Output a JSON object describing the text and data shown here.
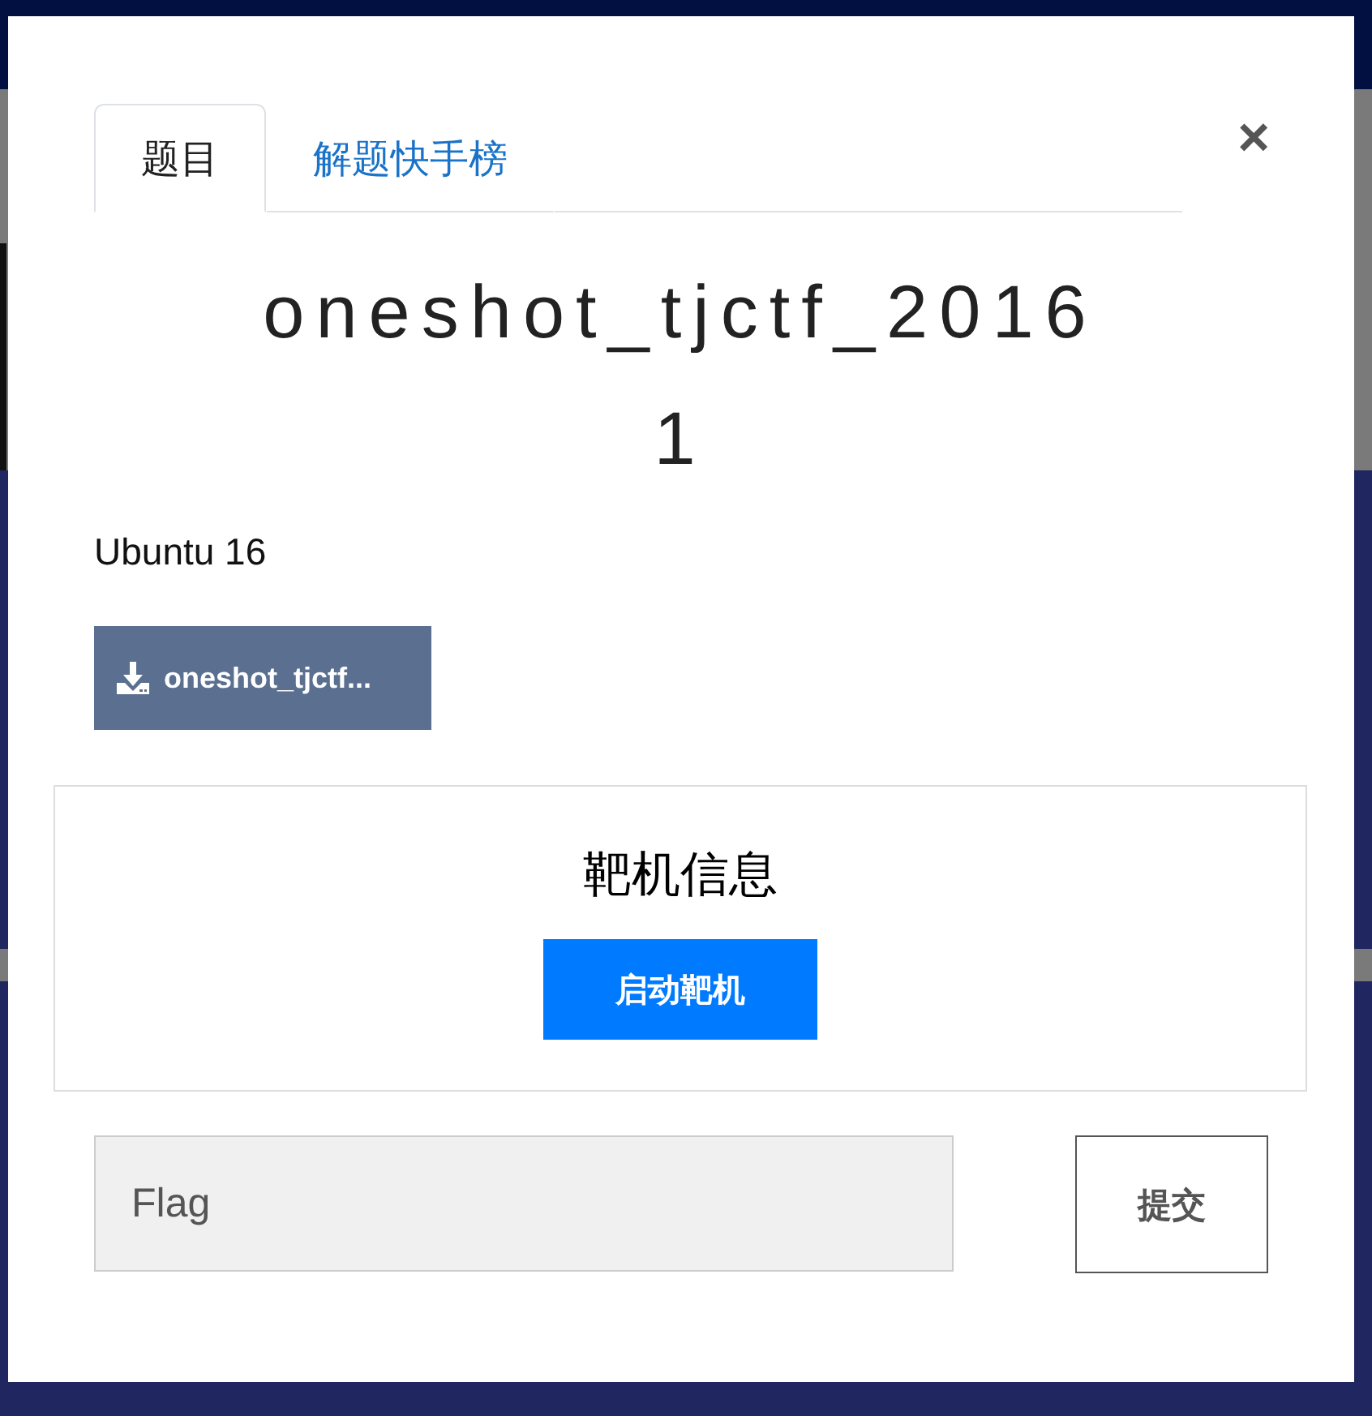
{
  "modal": {
    "tabs": [
      {
        "label": "题目",
        "selected": true
      },
      {
        "label": "解题快手榜",
        "selected": false
      }
    ],
    "close": "×",
    "title": "oneshot_tjctf_20161",
    "description": "Ubuntu 16",
    "file": "oneshot_tjctf...",
    "target": {
      "heading": "靶机信息",
      "button": "启动靶机"
    },
    "flag": {
      "placeholder": "Flag"
    },
    "submit": "提交"
  }
}
